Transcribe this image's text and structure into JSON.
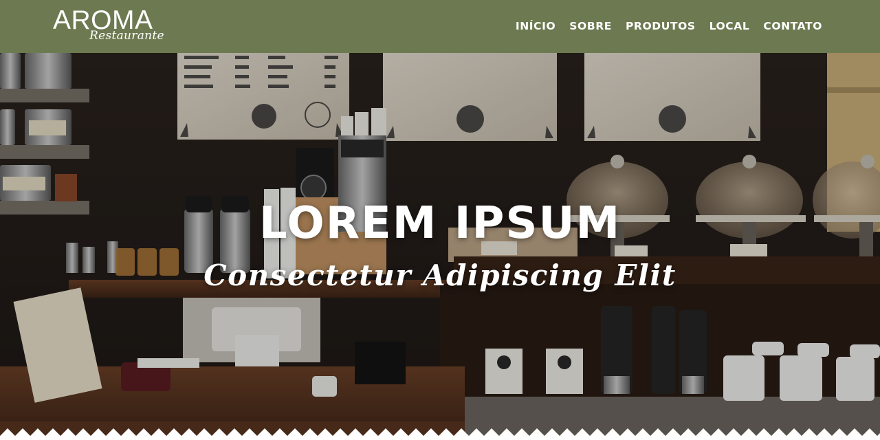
{
  "brand": {
    "name": "AROMA",
    "tagline": "Restaurante"
  },
  "nav": {
    "items": [
      {
        "label": "INÍCIO"
      },
      {
        "label": "SOBRE"
      },
      {
        "label": "PRODUTOS"
      },
      {
        "label": "LOCAL"
      },
      {
        "label": "CONTATO"
      }
    ]
  },
  "hero": {
    "title": "LOREM IPSUM",
    "subtitle": "Consectetur Adipiscing Elit"
  },
  "colors": {
    "navbar": "#6d7a51",
    "text": "#ffffff"
  }
}
